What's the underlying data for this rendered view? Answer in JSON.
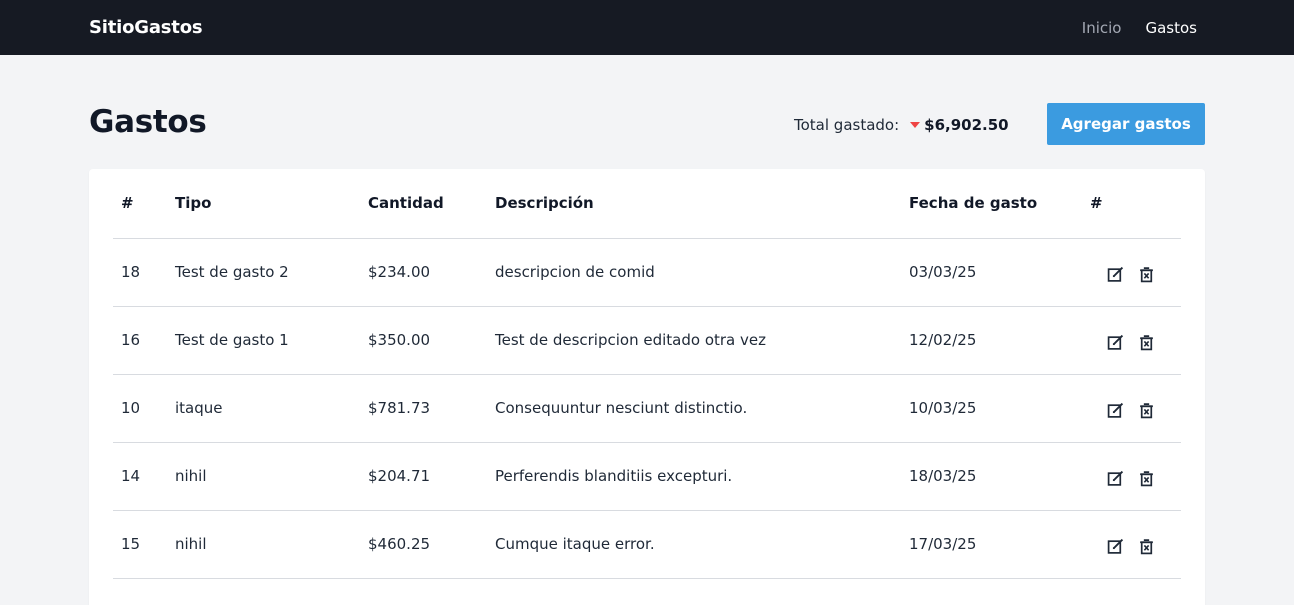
{
  "navbar": {
    "brand": "SitioGastos",
    "links": [
      {
        "label": "Inicio",
        "active": false
      },
      {
        "label": "Gastos",
        "active": true
      }
    ]
  },
  "header": {
    "title": "Gastos",
    "total_label": "Total gastado:",
    "total_trend_icon": "caret-down-icon",
    "total_trend_color": "#ef4444",
    "total_value": "$6,902.50",
    "add_button_label": "Agregar gastos"
  },
  "table": {
    "columns": [
      "#",
      "Tipo",
      "Cantidad",
      "Descripción",
      "Fecha de gasto",
      "#"
    ],
    "rows": [
      {
        "id": "18",
        "tipo": "Test de gasto 2",
        "cantidad": "$234.00",
        "descripcion": "descripcion de comid",
        "fecha": "03/03/25"
      },
      {
        "id": "16",
        "tipo": "Test de gasto 1",
        "cantidad": "$350.00",
        "descripcion": "Test de descripcion editado otra vez",
        "fecha": "12/02/25"
      },
      {
        "id": "10",
        "tipo": "itaque",
        "cantidad": "$781.73",
        "descripcion": "Consequuntur nesciunt distinctio.",
        "fecha": "10/03/25"
      },
      {
        "id": "14",
        "tipo": "nihil",
        "cantidad": "$204.71",
        "descripcion": "Perferendis blanditiis excepturi.",
        "fecha": "18/03/25"
      },
      {
        "id": "15",
        "tipo": "nihil",
        "cantidad": "$460.25",
        "descripcion": "Cumque itaque error.",
        "fecha": "17/03/25"
      }
    ],
    "row_actions": [
      "edit-icon",
      "delete-icon"
    ]
  },
  "colors": {
    "navbar_bg": "#161a23",
    "page_bg": "#f3f4f6",
    "accent": "#3b9be0"
  }
}
